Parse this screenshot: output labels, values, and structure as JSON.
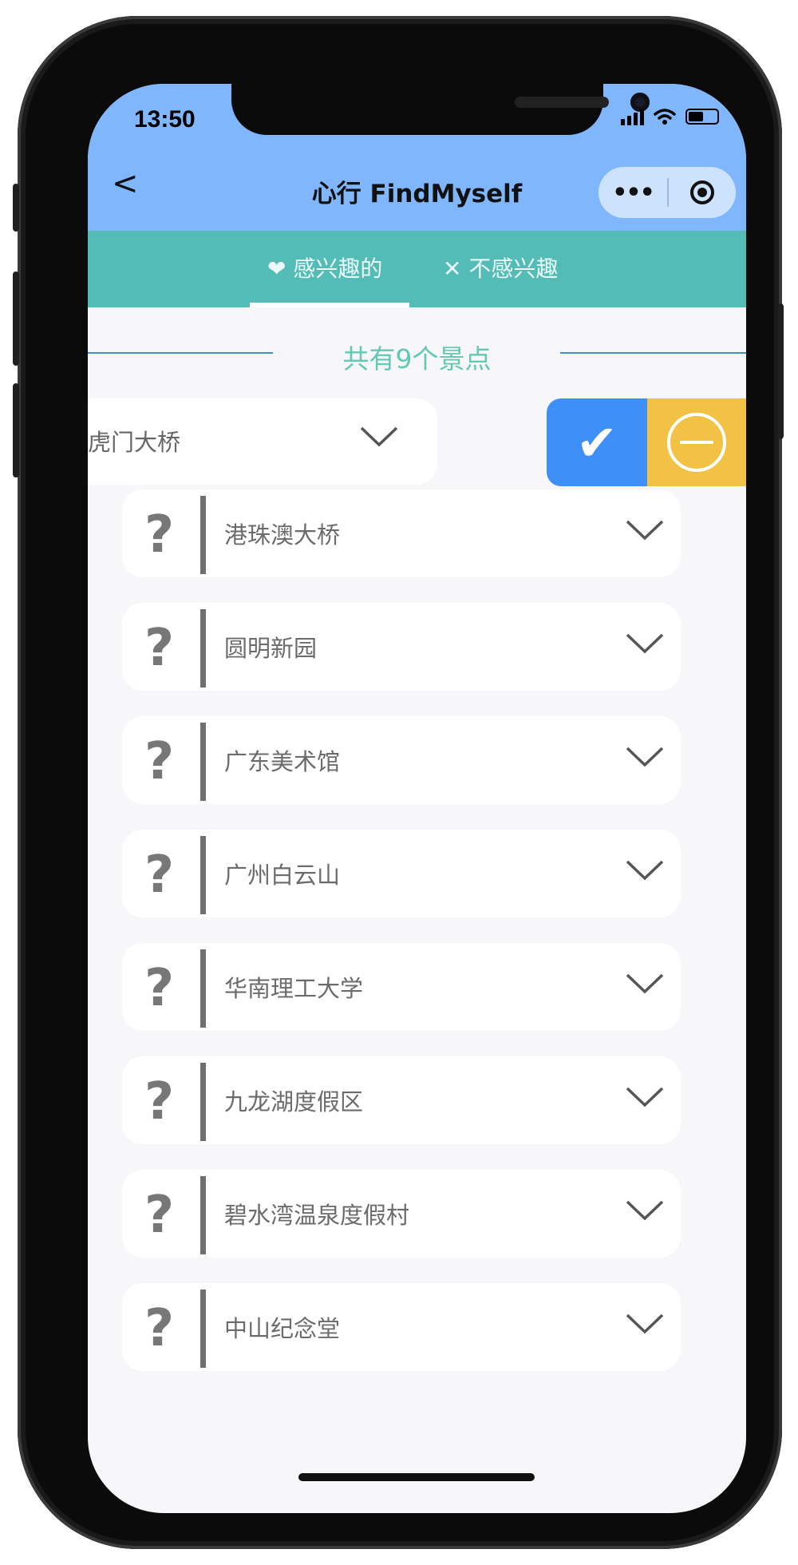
{
  "status_bar": {
    "time": "13:50"
  },
  "nav": {
    "back_glyph": "<",
    "title": "心行 FindMyself",
    "more_glyph": "•••"
  },
  "tabs": {
    "like": "❤ 感兴趣的",
    "dislike": "✕ 不感兴趣"
  },
  "summary": {
    "count_text": "共有9个景点"
  },
  "swiped_item": {
    "label": "虎门大桥",
    "confirm_glyph": "✔"
  },
  "places": [
    {
      "icon": "?",
      "name": "港珠澳大桥"
    },
    {
      "icon": "?",
      "name": "圆明新园"
    },
    {
      "icon": "?",
      "name": "广东美术馆"
    },
    {
      "icon": "?",
      "name": "广州白云山"
    },
    {
      "icon": "?",
      "name": "华南理工大学"
    },
    {
      "icon": "?",
      "name": "九龙湖度假区"
    },
    {
      "icon": "?",
      "name": "碧水湾温泉度假村"
    },
    {
      "icon": "?",
      "name": "中山纪念堂"
    }
  ],
  "colors": {
    "nav_bg": "#7fb6fc",
    "tab_bg": "#53bcb6",
    "count_text": "#62c9b3",
    "confirm": "#3f8ff8",
    "dismiss": "#f2c244"
  }
}
